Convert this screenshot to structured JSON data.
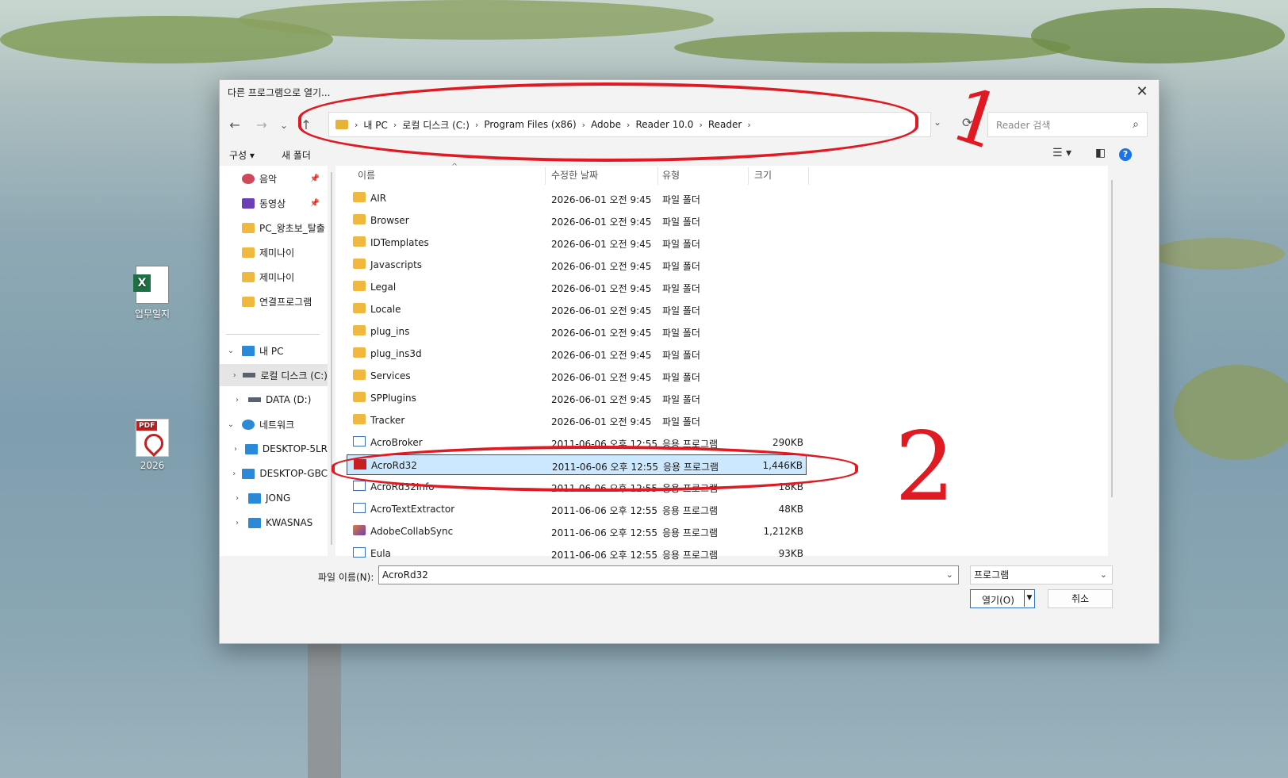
{
  "desktop": {
    "icons": [
      {
        "label": "업무일지",
        "type": "excel"
      },
      {
        "label": "2026",
        "type": "pdf"
      }
    ]
  },
  "dialog": {
    "title": "다른 프로그램으로 열기...",
    "close_glyph": "✕",
    "nav": {
      "back": "←",
      "forward": "→",
      "recent": "⌄",
      "up": "↑",
      "refresh": "⟳",
      "dropdown": "⌄"
    },
    "breadcrumbs": [
      "내 PC",
      "로컬 디스크 (C:)",
      "Program Files (x86)",
      "Adobe",
      "Reader 10.0",
      "Reader"
    ],
    "search_placeholder": "Reader 검색",
    "toolbar": {
      "organize": "구성 ▾",
      "new_folder": "새 폴더",
      "view": "☰ ▾",
      "pane": "◧",
      "help": "?"
    },
    "sidebar": [
      {
        "label": "음악",
        "icon": "music-icon",
        "pinned": true
      },
      {
        "label": "동영상",
        "icon": "video-icon",
        "pinned": true
      },
      {
        "label": "PC_왕초보_탈출",
        "icon": "folder-icon"
      },
      {
        "label": "제미나이",
        "icon": "folder-icon"
      },
      {
        "label": "제미나이",
        "icon": "folder-icon"
      },
      {
        "label": "연결프로그램",
        "icon": "folder-icon"
      },
      {
        "label": "내 PC",
        "icon": "pc-icon",
        "expanded": true
      },
      {
        "label": "로컬 디스크 (C:)",
        "icon": "drive-icon",
        "selected": true
      },
      {
        "label": "DATA (D:)",
        "icon": "drive-icon"
      },
      {
        "label": "네트워크",
        "icon": "network-icon",
        "expanded": true
      },
      {
        "label": "DESKTOP-5LR",
        "icon": "pc-icon"
      },
      {
        "label": "DESKTOP-GBC",
        "icon": "pc-icon"
      },
      {
        "label": "JONG",
        "icon": "pc-icon"
      },
      {
        "label": "KWASNAS",
        "icon": "pc-icon"
      }
    ],
    "columns": {
      "name": "이름",
      "modified": "수정한 날짜",
      "type": "유형",
      "size": "크기"
    },
    "files": [
      {
        "name": "AIR",
        "modified": "2026-06-01 오전 9:45",
        "type": "파일 폴더",
        "size": "",
        "kind": "folder"
      },
      {
        "name": "Browser",
        "modified": "2026-06-01 오전 9:45",
        "type": "파일 폴더",
        "size": "",
        "kind": "folder"
      },
      {
        "name": "IDTemplates",
        "modified": "2026-06-01 오전 9:45",
        "type": "파일 폴더",
        "size": "",
        "kind": "folder"
      },
      {
        "name": "Javascripts",
        "modified": "2026-06-01 오전 9:45",
        "type": "파일 폴더",
        "size": "",
        "kind": "folder"
      },
      {
        "name": "Legal",
        "modified": "2026-06-01 오전 9:45",
        "type": "파일 폴더",
        "size": "",
        "kind": "folder"
      },
      {
        "name": "Locale",
        "modified": "2026-06-01 오전 9:45",
        "type": "파일 폴더",
        "size": "",
        "kind": "folder"
      },
      {
        "name": "plug_ins",
        "modified": "2026-06-01 오전 9:45",
        "type": "파일 폴더",
        "size": "",
        "kind": "folder"
      },
      {
        "name": "plug_ins3d",
        "modified": "2026-06-01 오전 9:45",
        "type": "파일 폴더",
        "size": "",
        "kind": "folder"
      },
      {
        "name": "Services",
        "modified": "2026-06-01 오전 9:45",
        "type": "파일 폴더",
        "size": "",
        "kind": "folder"
      },
      {
        "name": "SPPlugins",
        "modified": "2026-06-01 오전 9:45",
        "type": "파일 폴더",
        "size": "",
        "kind": "folder"
      },
      {
        "name": "Tracker",
        "modified": "2026-06-01 오전 9:45",
        "type": "파일 폴더",
        "size": "",
        "kind": "folder"
      },
      {
        "name": "AcroBroker",
        "modified": "2011-06-06 오후 12:55",
        "type": "응용 프로그램",
        "size": "290KB",
        "kind": "app"
      },
      {
        "name": "AcroRd32",
        "modified": "2011-06-06 오후 12:55",
        "type": "응용 프로그램",
        "size": "1,446KB",
        "kind": "acro",
        "selected": true
      },
      {
        "name": "AcroRd32Info",
        "modified": "2011-06-06 오후 12:55",
        "type": "응용 프로그램",
        "size": "18KB",
        "kind": "app"
      },
      {
        "name": "AcroTextExtractor",
        "modified": "2011-06-06 오후 12:55",
        "type": "응용 프로그램",
        "size": "48KB",
        "kind": "app"
      },
      {
        "name": "AdobeCollabSync",
        "modified": "2011-06-06 오후 12:55",
        "type": "응용 프로그램",
        "size": "1,212KB",
        "kind": "collab"
      },
      {
        "name": "Eula",
        "modified": "2011-06-06 오후 12:55",
        "type": "응용 프로그램",
        "size": "93KB",
        "kind": "app"
      }
    ],
    "filename_label": "파일 이름(N):",
    "filename_value": "AcroRd32",
    "filetype_value": "프로그램",
    "open_label": "열기(O)",
    "cancel_label": "취소"
  },
  "annotations": {
    "mark1": "1",
    "mark2": "2",
    "color": "#e01a22"
  }
}
